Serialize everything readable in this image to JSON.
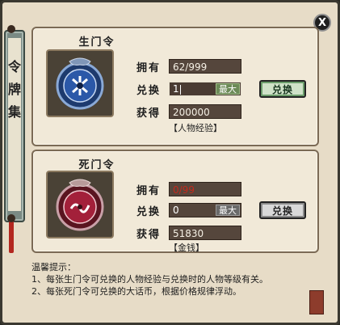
{
  "side_tab": {
    "chars": [
      "令",
      "牌",
      "集"
    ]
  },
  "close_label": "X",
  "panels": [
    {
      "title": "生门令",
      "icon": "blue-token-icon",
      "own_label": "拥有",
      "own_value": "62/999",
      "exchange_label": "兑换",
      "exchange_value": "1",
      "max_label": "最大",
      "gain_label": "获得",
      "gain_value": "200000",
      "reward_type": "【人物经验】",
      "button_label": "兑换"
    },
    {
      "title": "死门令",
      "icon": "red-token-icon",
      "own_label": "拥有",
      "own_value": "0/99",
      "exchange_label": "兑换",
      "exchange_value": "0",
      "max_label": "最大",
      "gain_label": "获得",
      "gain_value": "51830",
      "reward_type": "【金钱】",
      "button_label": "兑换"
    }
  ],
  "tips": {
    "header": "温馨提示：",
    "line1": "1、每张生门令可兑换的人物经验与兑换时的人物等级有关。",
    "line2": "2、每张死门令可兑换的大话币，根据价格规律浮动。"
  },
  "colors": {
    "accent_green": "#6c8a57",
    "warning_red": "#c42a1c"
  }
}
